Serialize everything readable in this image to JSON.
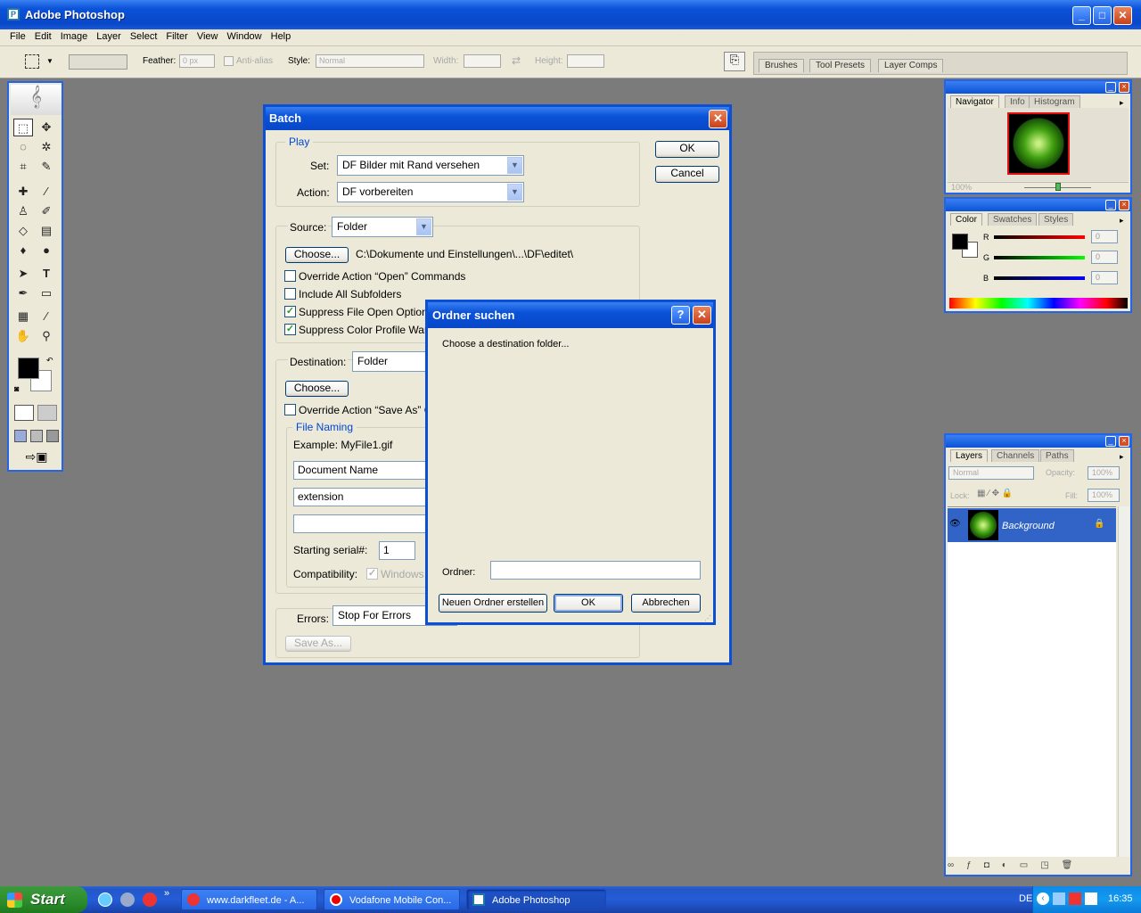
{
  "app": {
    "title": "Adobe Photoshop"
  },
  "menu": [
    "File",
    "Edit",
    "Image",
    "Layer",
    "Select",
    "Filter",
    "View",
    "Window",
    "Help"
  ],
  "options": {
    "feather_label": "Feather:",
    "feather_value": "0 px",
    "antialias_label": "Anti-alias",
    "style_label": "Style:",
    "style_value": "Normal",
    "width_label": "Width:",
    "height_label": "Height:"
  },
  "well_tabs": [
    "Brushes",
    "Tool Presets",
    "Layer Comps"
  ],
  "batch": {
    "title": "Batch",
    "ok": "OK",
    "cancel": "Cancel",
    "play_legend": "Play",
    "set_label": "Set:",
    "set_value": "DF Bilder mit Rand versehen",
    "action_label": "Action:",
    "action_value": "DF vorbereiten",
    "source_label": "Source:",
    "source_value": "Folder",
    "choose": "Choose...",
    "source_path": "C:\\Dokumente und Einstellungen\\...\\DF\\editet\\",
    "override_open": "Override Action “Open” Commands",
    "include_sub": "Include All Subfolders",
    "suppress_open": "Suppress File Open Options Dialogs",
    "suppress_color": "Suppress Color Profile Warnings",
    "dest_label": "Destination:",
    "dest_value": "Folder",
    "override_save": "Override Action “Save As” Commands",
    "naming_legend": "File Naming",
    "example": "Example: MyFile1.gif",
    "name1": "Document Name",
    "name2": "extension",
    "name3": "",
    "serial_label": "Starting serial#:",
    "serial_value": "1",
    "compat_label": "Compatibility:",
    "compat_windows": "Windows",
    "errors_label": "Errors:",
    "errors_value": "Stop For Errors",
    "save_as": "Save As..."
  },
  "folder_dialog": {
    "title": "Ordner suchen",
    "prompt": "Choose a destination folder...",
    "folder_label": "Ordner:",
    "folder_value": "",
    "new_folder": "Neuen Ordner erstellen",
    "ok": "OK",
    "cancel": "Abbrechen"
  },
  "navigator": {
    "tabs": [
      "Navigator",
      "Info",
      "Histogram"
    ],
    "zoom": "100%"
  },
  "color": {
    "tabs": [
      "Color",
      "Swatches",
      "Styles"
    ],
    "r": "R",
    "g": "G",
    "b": "B",
    "r_val": "0",
    "g_val": "0",
    "b_val": "0"
  },
  "layers": {
    "tabs": [
      "Layers",
      "Channels",
      "Paths"
    ],
    "blend": "Normal",
    "opacity_label": "Opacity:",
    "opacity": "100%",
    "lock_label": "Lock:",
    "fill_label": "Fill:",
    "fill": "100%",
    "layer_name": "Background"
  },
  "taskbar": {
    "start": "Start",
    "tasks": [
      "www.darkfleet.de - A...",
      "Vodafone Mobile Con...",
      "Adobe Photoshop"
    ],
    "lang": "DE",
    "clock": "16:35"
  }
}
